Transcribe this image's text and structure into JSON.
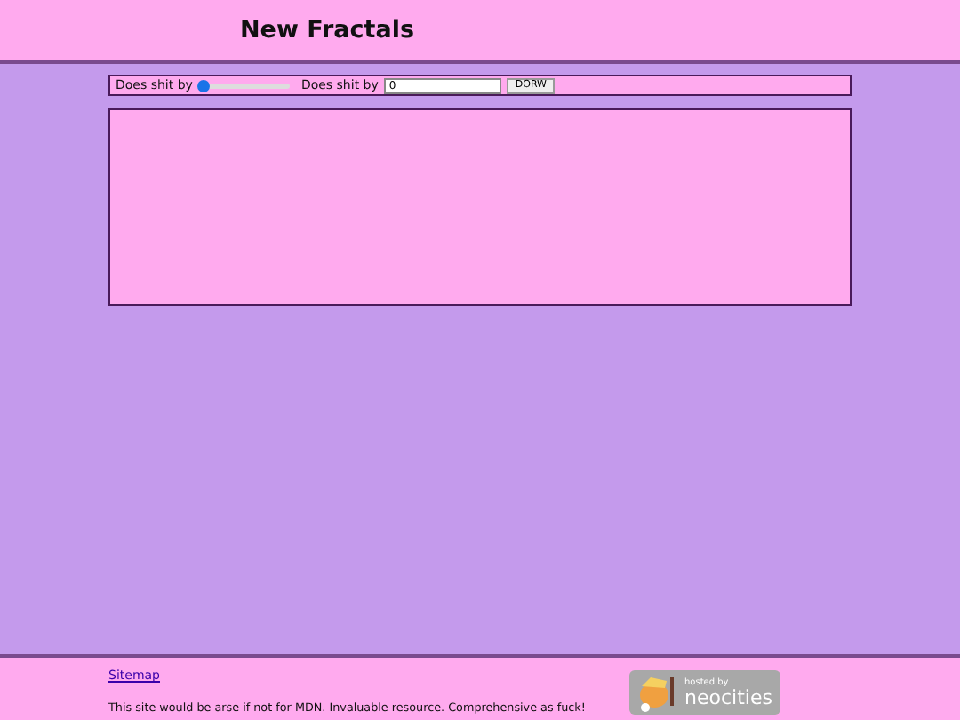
{
  "header": {
    "title": "New Fractals"
  },
  "controls": {
    "slider_label": "Does shit by",
    "slider": {
      "level": 0
    },
    "input_label": "Does shit by",
    "input_value": "0",
    "button": "DORW"
  },
  "footer": {
    "link": "Sitemap",
    "note": "This site would be arse if not for MDN. Invaluable resource. Comprehensive as fuck!",
    "badge": {
      "line1": "hosted by",
      "line2": "neocities"
    }
  }
}
